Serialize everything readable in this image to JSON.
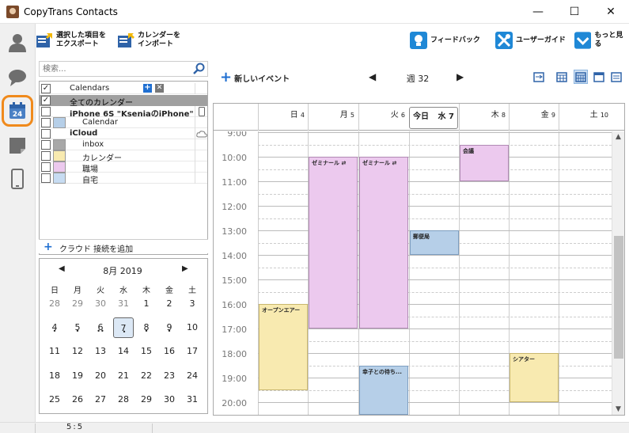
{
  "window": {
    "title": "CopyTrans Contacts",
    "minimize": "—",
    "maximize": "☐",
    "close": "✕"
  },
  "toolbar": {
    "export_l1": "選択した項目を",
    "export_l2": "エクスポート",
    "import_l1": "カレンダーを",
    "import_l2": "インポート",
    "feedback": "フィードバック",
    "guide": "ユーザーガイド",
    "more": "もっと見る"
  },
  "search": {
    "placeholder": "検索..."
  },
  "calendars": {
    "header": "Calendars",
    "all": "全てのカレンダー",
    "device": "iPhone 6S \"KseniaのiPhone\"",
    "device_cal": "Calendar",
    "cloud": "iCloud",
    "items": [
      {
        "label": "inbox",
        "color": "#a8a8a8"
      },
      {
        "label": "カレンダー",
        "color": "#f8eab0"
      },
      {
        "label": "職場",
        "color": "#ecc9ee"
      },
      {
        "label": "自宅",
        "color": "#c7dcf2"
      }
    ],
    "device_cal_color": "#b6cfe8",
    "add_cloud": "クラウド 接続を追加"
  },
  "mini_calendar": {
    "month": "8月 2019",
    "weekdays": [
      "月",
      "火",
      "水",
      "木",
      "金",
      "土"
    ],
    "weekday_first": "日",
    "weeks": [
      [
        "28",
        "29",
        "30",
        "31",
        "1",
        "2",
        "3"
      ],
      [
        "4",
        "5",
        "6",
        "7",
        "8",
        "9",
        "10"
      ],
      [
        "11",
        "12",
        "13",
        "14",
        "15",
        "16",
        "17"
      ],
      [
        "18",
        "19",
        "20",
        "21",
        "22",
        "23",
        "24"
      ],
      [
        "25",
        "26",
        "27",
        "28",
        "29",
        "30",
        "31"
      ]
    ]
  },
  "week_view": {
    "new_event": "新しいイベント",
    "week_label": "週 32",
    "days": [
      {
        "name": "日",
        "num": "4"
      },
      {
        "name": "月",
        "num": "5"
      },
      {
        "name": "火",
        "num": "6"
      },
      {
        "name": "水",
        "num": "7"
      },
      {
        "name": "木",
        "num": "8"
      },
      {
        "name": "金",
        "num": "9"
      },
      {
        "name": "土",
        "num": "10"
      }
    ],
    "today_label": "今日",
    "today_day": "水 7",
    "hours": [
      "9:00",
      "10:00",
      "11:00",
      "12:00",
      "13:00",
      "14:00",
      "15:00",
      "16:00",
      "17:00",
      "18:00",
      "19:00",
      "20:00"
    ],
    "events": [
      {
        "title": "ゼミナール",
        "day": 1,
        "start": 10.0,
        "end": 17.0,
        "color": "pink",
        "recurring": "⇄"
      },
      {
        "title": "ゼミナール",
        "day": 2,
        "start": 10.0,
        "end": 17.0,
        "color": "pink",
        "recurring": "⇄"
      },
      {
        "title": "会議",
        "day": 4,
        "start": 9.5,
        "end": 11.0,
        "color": "pink",
        "recurring": ""
      },
      {
        "title": "郵便局",
        "day": 3,
        "start": 13.0,
        "end": 14.0,
        "color": "blue",
        "recurring": ""
      },
      {
        "title": "オープンエアー",
        "day": 0,
        "start": 16.0,
        "end": 19.5,
        "color": "yellow",
        "recurring": ""
      },
      {
        "title": "シアター",
        "day": 5,
        "start": 18.0,
        "end": 20.0,
        "color": "yellow",
        "recurring": ""
      },
      {
        "title": "幸子との待ち...",
        "day": 2,
        "start": 18.5,
        "end": 20.5,
        "color": "blue",
        "recurring": ""
      }
    ]
  },
  "status": {
    "text": "5:5"
  }
}
